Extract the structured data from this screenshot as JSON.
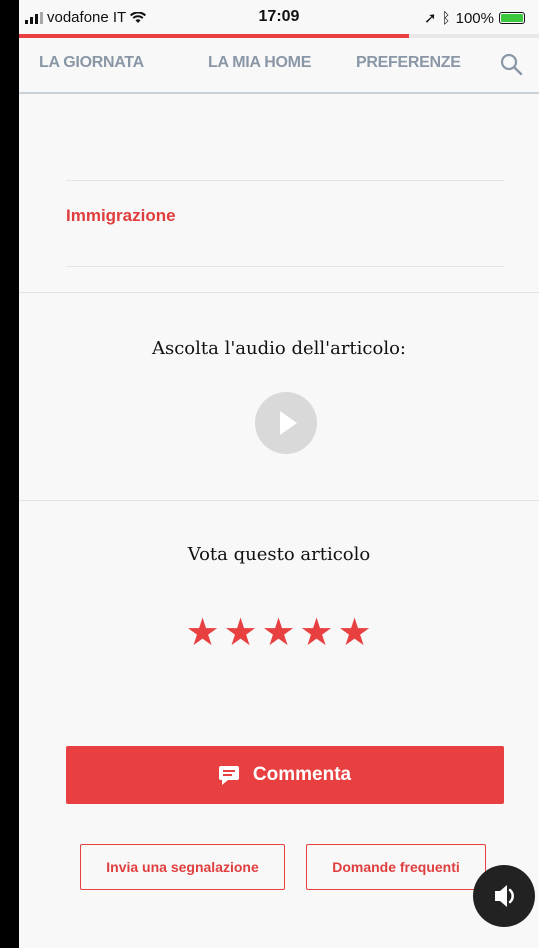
{
  "status_bar": {
    "carrier": "vodafone IT",
    "time": "17:09",
    "battery": "100%"
  },
  "reading_progress": 0.75,
  "nav": {
    "tabs": [
      "LA GIORNATA",
      "LA MIA HOME",
      "PREFERENZE"
    ]
  },
  "article": {
    "tag": "Immigrazione"
  },
  "audio": {
    "title": "Ascolta l'audio dell'articolo:"
  },
  "rating": {
    "title": "Vota questo articolo",
    "stars": 5
  },
  "actions": {
    "comment_label": "Commenta",
    "report_label": "Invia una segnalazione",
    "faq_label": "Domande frequenti"
  },
  "colors": {
    "accent": "#e84040",
    "nav_text": "#8a97a6"
  }
}
